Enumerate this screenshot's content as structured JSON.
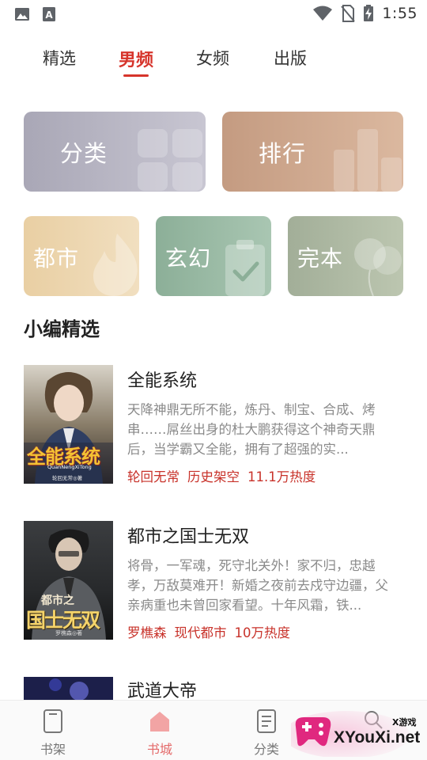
{
  "status_bar": {
    "time": "1:55",
    "left_icons": [
      "image-icon",
      "a-notification-icon"
    ],
    "right_icons": [
      "wifi-icon",
      "no-sim-icon",
      "battery-charging-icon"
    ]
  },
  "tabs": [
    {
      "label": "精选",
      "active": false
    },
    {
      "label": "男频",
      "active": true
    },
    {
      "label": "女频",
      "active": false
    },
    {
      "label": "出版",
      "active": false
    }
  ],
  "cards": {
    "category": "分类",
    "ranking": "排行",
    "urban": "都市",
    "fantasy": "玄幻",
    "completed": "完本"
  },
  "section_title": "小编精选",
  "books": [
    {
      "title": "全能系统",
      "desc": "天降神鼎无所不能，炼丹、制宝、合成、烤串……屌丝出身的杜大鹏获得这个神奇天鼎后，当学霸又全能，拥有了超强的实...",
      "author": "轮回无常",
      "genre": "历史架空",
      "heat": "11.1万热度",
      "cover_title": "全能系统",
      "cover_pinyin": "QuanNengXiTong",
      "cover_author": "轮回无常◎著"
    },
    {
      "title": "都市之国士无双",
      "desc": "将骨，一军魂，死守北关外！家不归，忠越孝，万敌莫难开！新婚之夜前去戍守边疆，父亲病重也未曾回家看望。十年风霜，铁...",
      "author": "罗樵森",
      "genre": "现代都市",
      "heat": "10万热度",
      "cover_title_small": "都市之",
      "cover_title": "国士无双",
      "cover_author": "罗樵森◎著"
    },
    {
      "title": "武道大帝"
    }
  ],
  "bottom_nav": [
    {
      "label": "书架",
      "icon": "bookshelf-icon",
      "active": false
    },
    {
      "label": "书城",
      "icon": "bookstore-icon",
      "active": true
    },
    {
      "label": "分类",
      "icon": "category-icon",
      "active": false
    },
    {
      "label": "",
      "icon": "search-icon",
      "active": false
    }
  ],
  "watermark": {
    "top": "X游戏",
    "main": "XYouXi.net"
  },
  "colors": {
    "accent": "#d6342b",
    "meta_red": "#c8322a",
    "desc_gray": "#8a8a8a"
  }
}
